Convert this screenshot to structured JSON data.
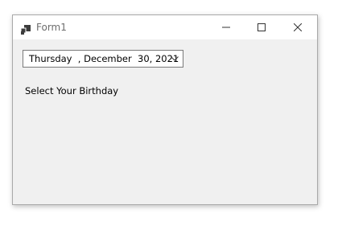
{
  "window": {
    "title": "Form1",
    "titlebar_buttons": [
      "minimize",
      "maximize",
      "close"
    ]
  },
  "date_picker": {
    "value": "Thursday  , December  30, 2021",
    "icon": "chevron-down-icon"
  },
  "label": {
    "text": "Select Your Birthday"
  },
  "colors": {
    "window_bg": "#f0f0f0",
    "titlebar_bg": "#ffffff",
    "title_text": "#6d6d6d",
    "border": "#7a7a7a"
  }
}
